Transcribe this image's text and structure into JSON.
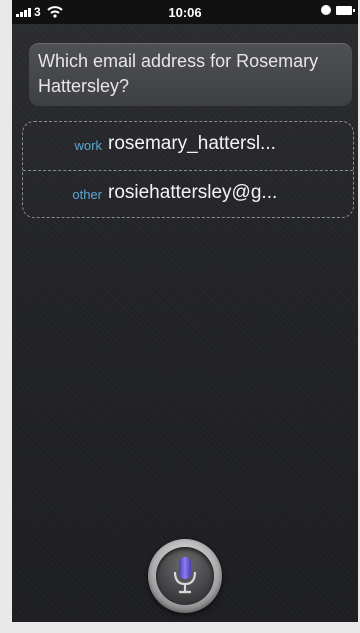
{
  "status_bar": {
    "carrier": "3",
    "time": "10:06"
  },
  "siri": {
    "question": "Which email address for Rosemary Hattersley?",
    "options": [
      {
        "type": "work",
        "value": "rosemary_hattersl..."
      },
      {
        "type": "other",
        "value": "rosiehattersley@g..."
      }
    ]
  },
  "colors": {
    "label_blue": "#5aa7d1",
    "mic_purple": "#6b5bd6"
  }
}
